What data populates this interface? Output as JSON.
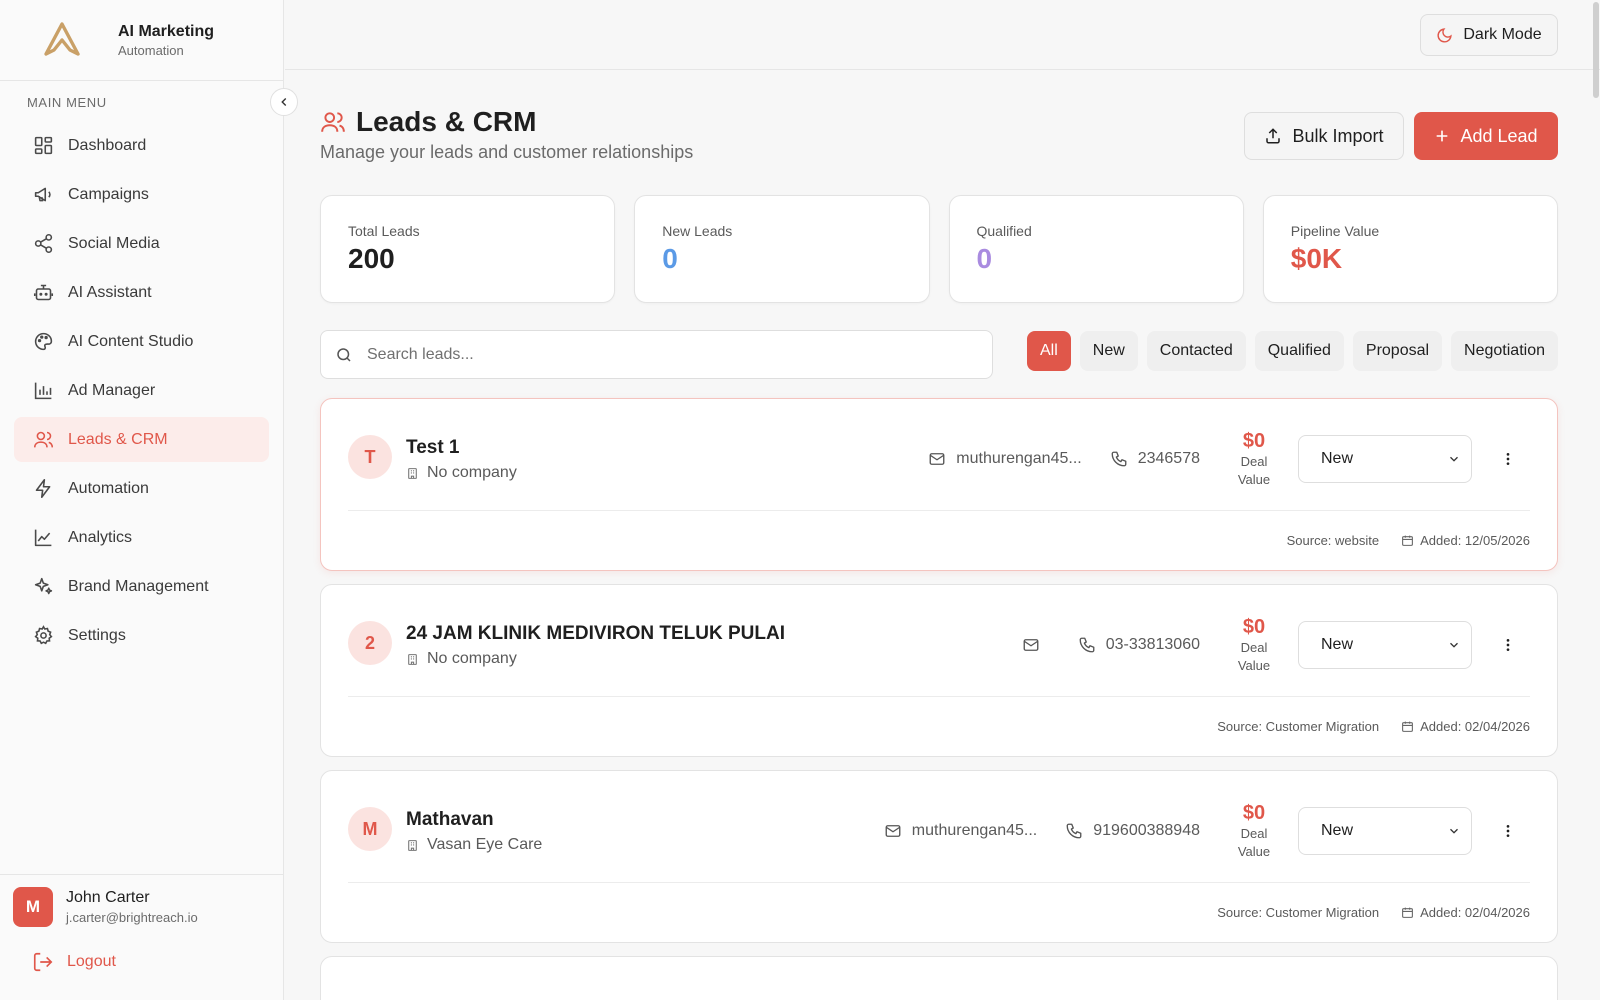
{
  "brand": {
    "title": "AI Marketing",
    "subtitle": "Automation"
  },
  "sidebar": {
    "menu_label": "MAIN MENU",
    "items": [
      {
        "label": "Dashboard",
        "icon": "dashboard-icon"
      },
      {
        "label": "Campaigns",
        "icon": "megaphone-icon"
      },
      {
        "label": "Social Media",
        "icon": "share-icon"
      },
      {
        "label": "AI Assistant",
        "icon": "bot-icon"
      },
      {
        "label": "AI Content Studio",
        "icon": "palette-icon"
      },
      {
        "label": "Ad Manager",
        "icon": "bar-chart-icon"
      },
      {
        "label": "Leads & CRM",
        "icon": "users-icon",
        "active": true
      },
      {
        "label": "Automation",
        "icon": "bolt-icon"
      },
      {
        "label": "Analytics",
        "icon": "line-chart-icon"
      },
      {
        "label": "Brand Management",
        "icon": "sparkles-icon"
      },
      {
        "label": "Settings",
        "icon": "gear-icon"
      }
    ]
  },
  "user": {
    "initial": "M",
    "name": "John Carter",
    "email": "j.carter@brightreach.io",
    "logout_label": "Logout"
  },
  "topbar": {
    "dark_mode_label": "Dark Mode"
  },
  "page": {
    "title": "Leads & CRM",
    "subtitle": "Manage your leads and customer relationships",
    "bulk_import_label": "Bulk Import",
    "add_lead_label": "Add Lead"
  },
  "stats": [
    {
      "label": "Total Leads",
      "value": "200",
      "color": "#1f1f1f"
    },
    {
      "label": "New Leads",
      "value": "0",
      "color": "#5b9ae6"
    },
    {
      "label": "Qualified",
      "value": "0",
      "color": "#a98be0"
    },
    {
      "label": "Pipeline Value",
      "value": "$0K",
      "color": "#e0574a"
    }
  ],
  "search": {
    "placeholder": "Search leads..."
  },
  "filters": [
    "All",
    "New",
    "Contacted",
    "Qualified",
    "Proposal",
    "Negotiation"
  ],
  "leads": [
    {
      "initial": "T",
      "name": "Test 1",
      "company": "No company",
      "email": "muthurengan45...",
      "phone": "2346578",
      "deal_value": "$0",
      "deal_label": "Deal Value",
      "status": "New",
      "source": "Source: website",
      "added": "Added: 12/05/2026"
    },
    {
      "initial": "2",
      "name": "24 JAM KLINIK MEDIVIRON TELUK PULAI",
      "company": "No company",
      "email": "",
      "phone": "03-33813060",
      "deal_value": "$0",
      "deal_label": "Deal Value",
      "status": "New",
      "source": "Source: Customer Migration",
      "added": "Added: 02/04/2026"
    },
    {
      "initial": "M",
      "name": "Mathavan",
      "company": "Vasan Eye Care",
      "email": "muthurengan45...",
      "phone": "919600388948",
      "deal_value": "$0",
      "deal_label": "Deal Value",
      "status": "New",
      "source": "Source: Customer Migration",
      "added": "Added: 02/04/2026"
    }
  ],
  "colors": {
    "accent": "#e0574a",
    "accent_soft": "#fcecea"
  }
}
